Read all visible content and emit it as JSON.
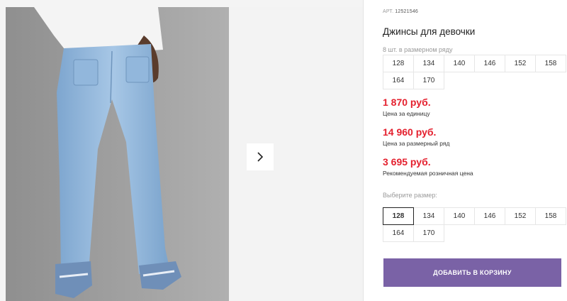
{
  "product": {
    "article_label": "АРТ.",
    "article_value": "12521546",
    "title": "Джинсы для девочки"
  },
  "size_grid_info": {
    "caption": "8 шт. в размерном ряду",
    "sizes": [
      "128",
      "134",
      "140",
      "146",
      "152",
      "158",
      "164",
      "170"
    ]
  },
  "prices": [
    {
      "amount": "1 870 руб.",
      "label": "Цена за единицу"
    },
    {
      "amount": "14 960 руб.",
      "label": "Цена за размерный ряд"
    },
    {
      "amount": "3 695 руб.",
      "label": "Рекомендуемая розничная цена"
    }
  ],
  "size_picker": {
    "label": "Выберите размер:",
    "sizes": [
      "128",
      "134",
      "140",
      "146",
      "152",
      "158",
      "164",
      "170"
    ],
    "selected": "128"
  },
  "cart_button": {
    "label": "ДОБАВИТЬ В КОРЗИНУ"
  },
  "colors": {
    "price_red": "#e4202e",
    "button_purple": "#7a62a6",
    "jeans_blue": "#8db4d8"
  },
  "icons": {
    "next": "chevron-right-icon"
  }
}
